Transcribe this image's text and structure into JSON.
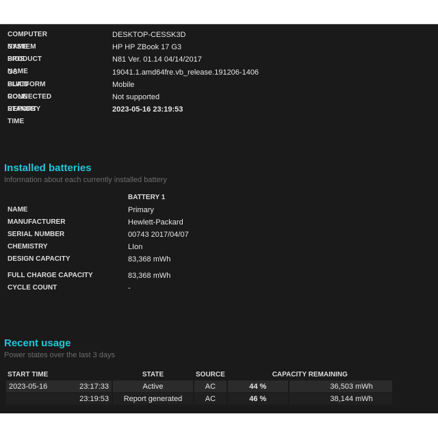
{
  "system": [
    {
      "label": "COMPUTER NAME",
      "value": "DESKTOP-CESSK3D"
    },
    {
      "label": "SYSTEM PRODUCT NAME",
      "value": "HP HP ZBook 17 G3"
    },
    {
      "label": "BIOS",
      "value": "N81 Ver. 01.14 04/14/2017"
    },
    {
      "label": "OS BUILD",
      "value": "19041.1.amd64fre.vb_release.191206-1406"
    },
    {
      "label": "PLATFORM ROLE",
      "value": "Mobile"
    },
    {
      "label": "CONNECTED STANDBY",
      "value": "Not supported"
    },
    {
      "label": "REPORT TIME",
      "value": "2023-05-16  23:19:53"
    }
  ],
  "installed_batteries": {
    "title": "Installed batteries",
    "subtitle": "Information about each currently installed battery",
    "column": "BATTERY 1",
    "rows": [
      {
        "label": "NAME",
        "value": "Primary"
      },
      {
        "label": "MANUFACTURER",
        "value": "Hewlett-Packard"
      },
      {
        "label": "SERIAL NUMBER",
        "value": "00743 2017/04/07"
      },
      {
        "label": "CHEMISTRY",
        "value": "LIon"
      },
      {
        "label": "DESIGN CAPACITY",
        "value": "83,368 mWh"
      },
      {
        "label": "FULL CHARGE CAPACITY",
        "value": "83,368 mWh"
      },
      {
        "label": "CYCLE COUNT",
        "value": "-"
      }
    ]
  },
  "recent_usage": {
    "title": "Recent usage",
    "subtitle": "Power states over the last 3 days",
    "headers": {
      "start_time": "START TIME",
      "state": "STATE",
      "source": "SOURCE",
      "capacity": "CAPACITY REMAINING"
    },
    "rows": [
      {
        "date": "2023-05-16",
        "time": "23:17:33",
        "state": "Active",
        "source": "AC",
        "percent": "44 %",
        "mwh": "36,503 mWh"
      },
      {
        "date": "",
        "time": "23:19:53",
        "state": "Report generated",
        "source": "AC",
        "percent": "46 %",
        "mwh": "38,144 mWh"
      }
    ]
  }
}
